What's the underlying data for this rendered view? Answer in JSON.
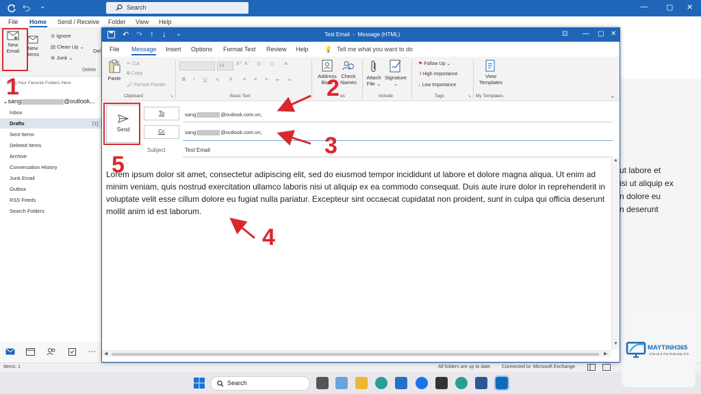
{
  "main_window": {
    "search_placeholder": "Search",
    "tabs": [
      "File",
      "Home",
      "Send / Receive",
      "Folder",
      "View",
      "Help"
    ],
    "ribbon": {
      "new_email": "New\nEmail",
      "new_items": "New\nItems",
      "ignore": "Ignore",
      "clean_up": "Clean Up",
      "junk": "Junk",
      "del": "Del",
      "delete_group": "Delete"
    },
    "favorites_hint": "Drag Your Favorite Folders Here",
    "account": {
      "prefix": "sang",
      "suffix": "@outlook..."
    },
    "folders": [
      {
        "name": "Inbox",
        "count": ""
      },
      {
        "name": "Drafts",
        "count": "[1]"
      },
      {
        "name": "Sent Items",
        "count": ""
      },
      {
        "name": "Deleted Items",
        "count": ""
      },
      {
        "name": "Archive",
        "count": ""
      },
      {
        "name": "Conversation History",
        "count": ""
      },
      {
        "name": "Junk Email",
        "count": ""
      },
      {
        "name": "Outbox",
        "count": ""
      },
      {
        "name": "RSS Feeds",
        "count": ""
      },
      {
        "name": "Search Folders",
        "count": ""
      }
    ],
    "status_left": "Items: 1",
    "status_mid": "All folders are up to date.",
    "status_conn": "Connected to: Microsoft Exchange",
    "reading_pane_text": "ut labore et\nisi ut aliquip ex\nn dolore eu\nn deserunt",
    "taskbar_search": "Search",
    "watermark_brand": "MAYTINH365",
    "watermark_tagline": "Chia sẻ & Thủ thuật Máy tính"
  },
  "message_window": {
    "title": "Test Email  -  Message (HTML)",
    "tabs": [
      "File",
      "Message",
      "Insert",
      "Options",
      "Format Text",
      "Review",
      "Help"
    ],
    "tell_me": "Tell me what you want to do",
    "ribbon": {
      "paste": "Paste",
      "cut": "Cut",
      "copy": "Copy",
      "format_painter": "Format Painter",
      "clipboard": "Clipboard",
      "font_size": "14",
      "basic_text": "Basic Text",
      "address_book": "Address\nBook",
      "check_names": "Check\nNames",
      "names_group": "es",
      "attach_file": "Attach\nFile",
      "signature": "Signature",
      "include": "Include",
      "follow_up": "Follow Up",
      "high_importance": "High Importance",
      "low_importance": "Low Importance",
      "tags": "Tags",
      "view_templates": "View\nTemplates",
      "my_templates": "My Templates"
    },
    "send_label": "Send",
    "to_label": "To",
    "cc_label": "Cc",
    "subject_label": "Subject",
    "to_value": {
      "prefix": "sang",
      "suffix": "@outlook.com.vn;"
    },
    "cc_value": {
      "prefix": "sang",
      "suffix": "@outlook.com.vn;"
    },
    "subject_value": "Test Email",
    "body": "Lorem ipsum dolor sit amet, consectetur adipiscing elit, sed do eiusmod tempor incididunt ut labore et dolore magna aliqua. Ut enim ad minim veniam, quis nostrud exercitation ullamco laboris nisi ut aliquip ex ea commodo consequat. Duis aute irure dolor in reprehenderit in voluptate velit esse cillum dolore eu fugiat nulla pariatur. Excepteur sint occaecat cupidatat non proident, sunt in culpa qui officia deserunt mollit anim id est laborum."
  },
  "annotations": [
    "1",
    "2",
    "3",
    "4",
    "5"
  ],
  "colors": {
    "title_blue": "#1f66b9",
    "annotation_red": "#d9272e"
  }
}
